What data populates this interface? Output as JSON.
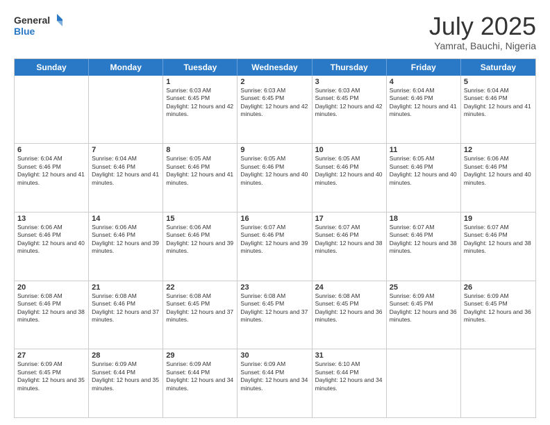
{
  "logo": {
    "line1": "General",
    "line2": "Blue"
  },
  "header": {
    "month": "July 2025",
    "location": "Yamrat, Bauchi, Nigeria"
  },
  "weekdays": [
    "Sunday",
    "Monday",
    "Tuesday",
    "Wednesday",
    "Thursday",
    "Friday",
    "Saturday"
  ],
  "weeks": [
    [
      {
        "day": "",
        "info": ""
      },
      {
        "day": "",
        "info": ""
      },
      {
        "day": "1",
        "info": "Sunrise: 6:03 AM\nSunset: 6:45 PM\nDaylight: 12 hours and 42 minutes."
      },
      {
        "day": "2",
        "info": "Sunrise: 6:03 AM\nSunset: 6:45 PM\nDaylight: 12 hours and 42 minutes."
      },
      {
        "day": "3",
        "info": "Sunrise: 6:03 AM\nSunset: 6:45 PM\nDaylight: 12 hours and 42 minutes."
      },
      {
        "day": "4",
        "info": "Sunrise: 6:04 AM\nSunset: 6:46 PM\nDaylight: 12 hours and 41 minutes."
      },
      {
        "day": "5",
        "info": "Sunrise: 6:04 AM\nSunset: 6:46 PM\nDaylight: 12 hours and 41 minutes."
      }
    ],
    [
      {
        "day": "6",
        "info": "Sunrise: 6:04 AM\nSunset: 6:46 PM\nDaylight: 12 hours and 41 minutes."
      },
      {
        "day": "7",
        "info": "Sunrise: 6:04 AM\nSunset: 6:46 PM\nDaylight: 12 hours and 41 minutes."
      },
      {
        "day": "8",
        "info": "Sunrise: 6:05 AM\nSunset: 6:46 PM\nDaylight: 12 hours and 41 minutes."
      },
      {
        "day": "9",
        "info": "Sunrise: 6:05 AM\nSunset: 6:46 PM\nDaylight: 12 hours and 40 minutes."
      },
      {
        "day": "10",
        "info": "Sunrise: 6:05 AM\nSunset: 6:46 PM\nDaylight: 12 hours and 40 minutes."
      },
      {
        "day": "11",
        "info": "Sunrise: 6:05 AM\nSunset: 6:46 PM\nDaylight: 12 hours and 40 minutes."
      },
      {
        "day": "12",
        "info": "Sunrise: 6:06 AM\nSunset: 6:46 PM\nDaylight: 12 hours and 40 minutes."
      }
    ],
    [
      {
        "day": "13",
        "info": "Sunrise: 6:06 AM\nSunset: 6:46 PM\nDaylight: 12 hours and 40 minutes."
      },
      {
        "day": "14",
        "info": "Sunrise: 6:06 AM\nSunset: 6:46 PM\nDaylight: 12 hours and 39 minutes."
      },
      {
        "day": "15",
        "info": "Sunrise: 6:06 AM\nSunset: 6:46 PM\nDaylight: 12 hours and 39 minutes."
      },
      {
        "day": "16",
        "info": "Sunrise: 6:07 AM\nSunset: 6:46 PM\nDaylight: 12 hours and 39 minutes."
      },
      {
        "day": "17",
        "info": "Sunrise: 6:07 AM\nSunset: 6:46 PM\nDaylight: 12 hours and 38 minutes."
      },
      {
        "day": "18",
        "info": "Sunrise: 6:07 AM\nSunset: 6:46 PM\nDaylight: 12 hours and 38 minutes."
      },
      {
        "day": "19",
        "info": "Sunrise: 6:07 AM\nSunset: 6:46 PM\nDaylight: 12 hours and 38 minutes."
      }
    ],
    [
      {
        "day": "20",
        "info": "Sunrise: 6:08 AM\nSunset: 6:46 PM\nDaylight: 12 hours and 38 minutes."
      },
      {
        "day": "21",
        "info": "Sunrise: 6:08 AM\nSunset: 6:46 PM\nDaylight: 12 hours and 37 minutes."
      },
      {
        "day": "22",
        "info": "Sunrise: 6:08 AM\nSunset: 6:45 PM\nDaylight: 12 hours and 37 minutes."
      },
      {
        "day": "23",
        "info": "Sunrise: 6:08 AM\nSunset: 6:45 PM\nDaylight: 12 hours and 37 minutes."
      },
      {
        "day": "24",
        "info": "Sunrise: 6:08 AM\nSunset: 6:45 PM\nDaylight: 12 hours and 36 minutes."
      },
      {
        "day": "25",
        "info": "Sunrise: 6:09 AM\nSunset: 6:45 PM\nDaylight: 12 hours and 36 minutes."
      },
      {
        "day": "26",
        "info": "Sunrise: 6:09 AM\nSunset: 6:45 PM\nDaylight: 12 hours and 36 minutes."
      }
    ],
    [
      {
        "day": "27",
        "info": "Sunrise: 6:09 AM\nSunset: 6:45 PM\nDaylight: 12 hours and 35 minutes."
      },
      {
        "day": "28",
        "info": "Sunrise: 6:09 AM\nSunset: 6:44 PM\nDaylight: 12 hours and 35 minutes."
      },
      {
        "day": "29",
        "info": "Sunrise: 6:09 AM\nSunset: 6:44 PM\nDaylight: 12 hours and 34 minutes."
      },
      {
        "day": "30",
        "info": "Sunrise: 6:09 AM\nSunset: 6:44 PM\nDaylight: 12 hours and 34 minutes."
      },
      {
        "day": "31",
        "info": "Sunrise: 6:10 AM\nSunset: 6:44 PM\nDaylight: 12 hours and 34 minutes."
      },
      {
        "day": "",
        "info": ""
      },
      {
        "day": "",
        "info": ""
      }
    ]
  ]
}
